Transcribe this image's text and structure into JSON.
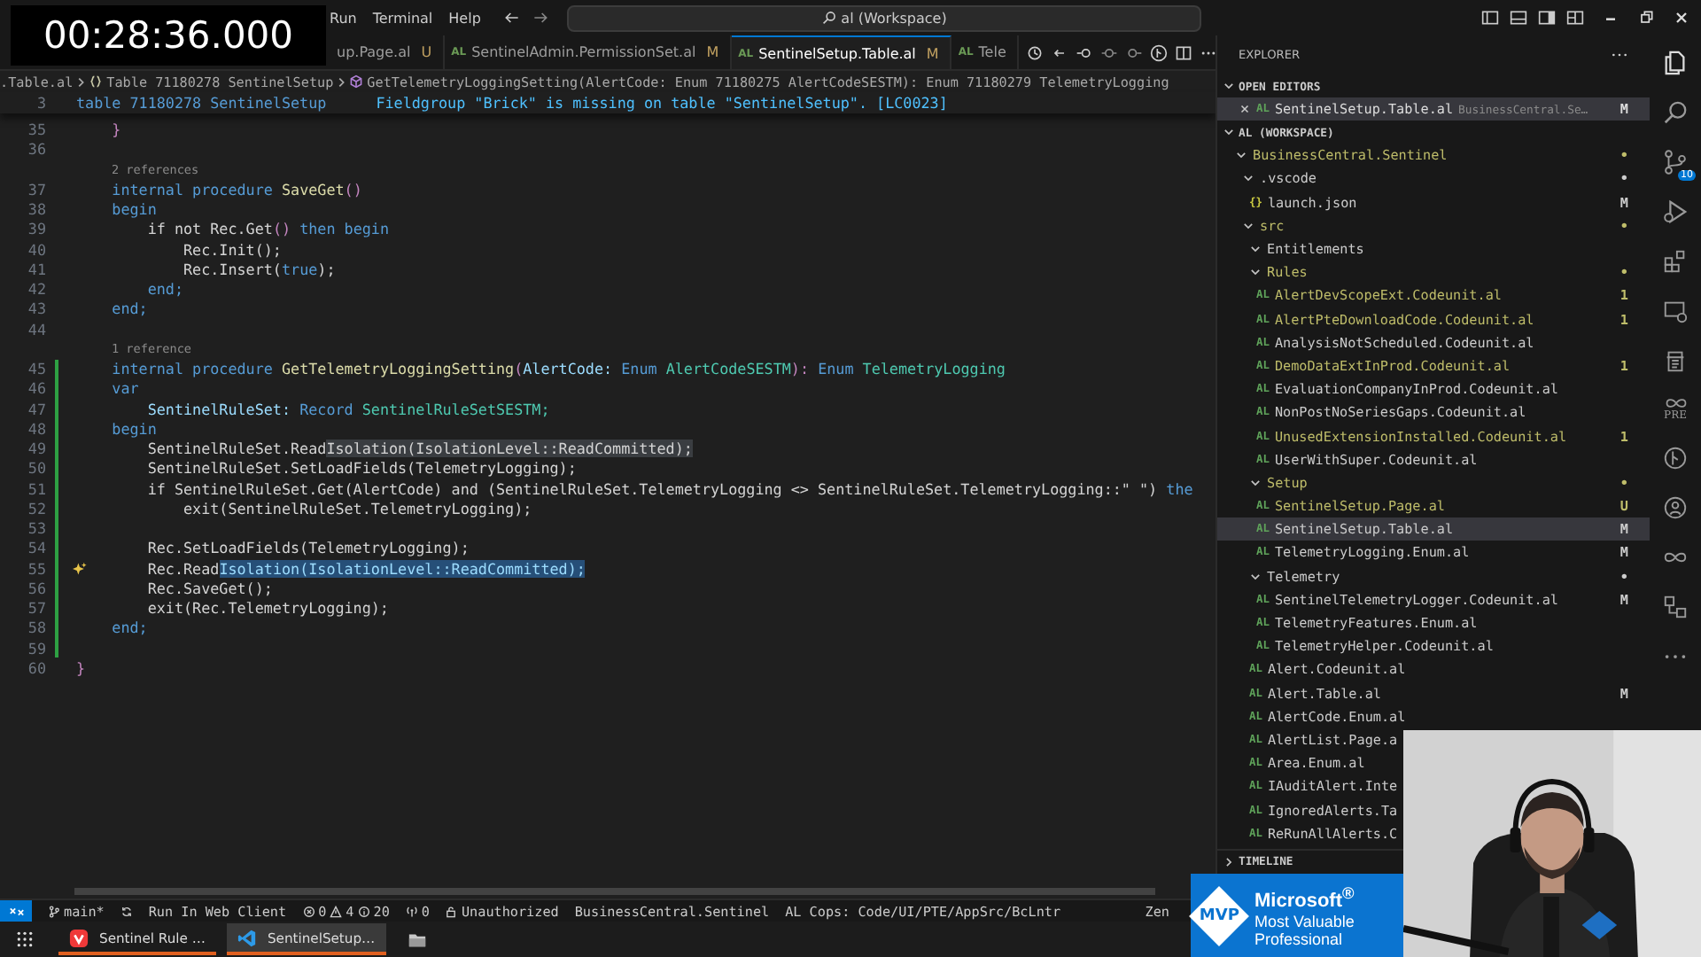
{
  "timer": "00:28:36.000",
  "menu": [
    "Run",
    "Terminal",
    "Help"
  ],
  "search": {
    "value": "al (Workspace)"
  },
  "tabs": [
    {
      "label": "up.Page.al",
      "badge": "U",
      "selected": false
    },
    {
      "icon": "AL",
      "label": "SentinelAdmin.PermissionSet.al",
      "badge": "M",
      "selected": false
    },
    {
      "icon": "AL",
      "label": "SentinelSetup.Table.al",
      "badge": "M",
      "selected": true
    },
    {
      "icon": "AL",
      "label": "Tele",
      "selected": false
    }
  ],
  "breadcrumb": [
    {
      "kind": "file",
      "text": ".Table.al"
    },
    {
      "kind": "table",
      "text": "Table 71180278 SentinelSetup"
    },
    {
      "kind": "method",
      "text": "GetTelemetryLoggingSetting(AlertCode: Enum 71180275 AlertCodeSESTM): Enum 71180279 TelemetryLogging"
    }
  ],
  "sticky": {
    "number": "3",
    "code": "table 71180278 SentinelSetup",
    "diagnostic": "Fieldgroup \"Brick\" is missing on table \"SentinelSetup\". [LC0023]"
  },
  "code": [
    {
      "kind": "code",
      "num": "35",
      "changed": false,
      "segs": [
        {
          "text": "    }",
          "kind": "control"
        }
      ]
    },
    {
      "kind": "code",
      "num": "36",
      "changed": false
    },
    {
      "kind": "lens",
      "text": "2 references"
    },
    {
      "kind": "code",
      "num": "37",
      "changed": false,
      "segs": [
        {
          "text": "    internal procedure ",
          "kind": "keyword"
        },
        {
          "text": "SaveGet",
          "kind": "function"
        },
        {
          "text": "()",
          "kind": "control"
        }
      ]
    },
    {
      "kind": "code",
      "num": "38",
      "changed": false,
      "segs": [
        {
          "text": "    begin",
          "kind": "keyword"
        }
      ]
    },
    {
      "kind": "code",
      "num": "39",
      "changed": false,
      "segs": [
        {
          "text": "        if not Rec.Get",
          "kind": "plain"
        },
        {
          "text": "()",
          "kind": "control"
        },
        {
          "text": " then begin",
          "kind": "keyword"
        }
      ]
    },
    {
      "kind": "code",
      "num": "40",
      "changed": false,
      "segs": [
        {
          "text": "            Rec.Init();",
          "kind": "plain"
        }
      ]
    },
    {
      "kind": "code",
      "num": "41",
      "changed": false,
      "segs": [
        {
          "text": "            Rec.Insert(",
          "kind": "plain"
        },
        {
          "text": "true",
          "kind": "keyword"
        },
        {
          "text": ");",
          "kind": "plain"
        }
      ]
    },
    {
      "kind": "code",
      "num": "42",
      "changed": false,
      "segs": [
        {
          "text": "        end;",
          "kind": "keyword"
        }
      ]
    },
    {
      "kind": "code",
      "num": "43",
      "changed": false,
      "segs": [
        {
          "text": "    end;",
          "kind": "keyword"
        }
      ]
    },
    {
      "kind": "code",
      "num": "44",
      "changed": false
    },
    {
      "kind": "lens",
      "text": "1 reference"
    },
    {
      "kind": "code",
      "num": "45",
      "changed": true,
      "segs": [
        {
          "text": "    internal procedure ",
          "kind": "keyword"
        },
        {
          "text": "GetTelemetryLoggingSetting",
          "kind": "function"
        },
        {
          "text": "(",
          "kind": "control"
        },
        {
          "text": "AlertCode: ",
          "kind": "variable"
        },
        {
          "text": "Enum ",
          "kind": "keyword"
        },
        {
          "text": "AlertCodeSESTM",
          "kind": "type"
        },
        {
          "text": "): ",
          "kind": "control"
        },
        {
          "text": "Enum ",
          "kind": "keyword"
        },
        {
          "text": "TelemetryLogging",
          "kind": "type"
        }
      ]
    },
    {
      "kind": "code",
      "num": "46",
      "changed": true,
      "segs": [
        {
          "text": "    var",
          "kind": "keyword"
        }
      ]
    },
    {
      "kind": "code",
      "num": "47",
      "changed": true,
      "segs": [
        {
          "text": "        SentinelRuleSet: ",
          "kind": "variable"
        },
        {
          "text": "Record ",
          "kind": "keyword"
        },
        {
          "text": "SentinelRuleSetSESTM;",
          "kind": "type"
        }
      ]
    },
    {
      "kind": "code",
      "num": "48",
      "changed": true,
      "segs": [
        {
          "text": "    begin",
          "kind": "keyword"
        }
      ]
    },
    {
      "kind": "code",
      "num": "49",
      "changed": true,
      "segs": [
        {
          "text": "        SentinelRuleSet.Read",
          "kind": "plain"
        },
        {
          "text": "Isolation(IsolationLevel::ReadCommitted);",
          "kind": "highlight"
        }
      ]
    },
    {
      "kind": "code",
      "num": "50",
      "changed": true,
      "segs": [
        {
          "text": "        SentinelRuleSet.SetLoadFields(TelemetryLogging);",
          "kind": "plain"
        }
      ]
    },
    {
      "kind": "code",
      "num": "51",
      "changed": true,
      "segs": [
        {
          "text": "        if SentinelRuleSet.Get(AlertCode) and (SentinelRuleSet.TelemetryLogging <> SentinelRuleSet.TelemetryLogging::\" \") ",
          "kind": "plain"
        },
        {
          "text": "the",
          "kind": "keyword"
        }
      ]
    },
    {
      "kind": "code",
      "num": "52",
      "changed": true,
      "segs": [
        {
          "text": "            exit(SentinelRuleSet.TelemetryLogging);",
          "kind": "plain"
        }
      ]
    },
    {
      "kind": "code",
      "num": "53",
      "changed": true
    },
    {
      "kind": "code",
      "num": "54",
      "changed": true,
      "segs": [
        {
          "text": "        Rec.SetLoadFields(TelemetryLogging);",
          "kind": "plain"
        }
      ]
    },
    {
      "kind": "hinted",
      "num": "55",
      "changed": true,
      "segs": [
        {
          "text": "        Rec.Read",
          "kind": "plain"
        },
        {
          "text": "Isolation(IsolationLevel::ReadCommitted);",
          "kind": "selection"
        }
      ]
    },
    {
      "kind": "code",
      "num": "56",
      "changed": true,
      "segs": [
        {
          "text": "        Rec.SaveGet();",
          "kind": "plain"
        }
      ]
    },
    {
      "kind": "code",
      "num": "57",
      "changed": true,
      "segs": [
        {
          "text": "        exit(Rec.TelemetryLogging);",
          "kind": "plain"
        }
      ]
    },
    {
      "kind": "code",
      "num": "58",
      "changed": true,
      "segs": [
        {
          "text": "    end;",
          "kind": "keyword"
        }
      ]
    },
    {
      "kind": "code",
      "num": "59",
      "changed": true
    },
    {
      "kind": "code",
      "num": "60",
      "changed": false,
      "segs": [
        {
          "text": "}",
          "kind": "control"
        }
      ]
    }
  ],
  "explorer": {
    "title": "EXPLORER"
  },
  "open_editors": {
    "title": "OPEN EDITORS",
    "expanded": true,
    "items": [
      {
        "icon": "AL",
        "name": "SentinelSetup.Table.al",
        "path": "BusinessCentral.Se…",
        "badge": "M",
        "selected": true
      }
    ]
  },
  "workspace": {
    "title": "AL (WORKSPACE)",
    "expanded": true,
    "tree": [
      {
        "name": "BusinessCentral.Sentinel",
        "color": "#bfbd6a",
        "badge": "•",
        "selected": false,
        "expanded": true,
        "children": [
          {
            "name": ".vscode",
            "color": "#cccccc",
            "badge": "•",
            "selected": false,
            "expanded": true,
            "children": [
              {
                "icon": "{}",
                "name": "launch.json",
                "color": "#cccccc",
                "badge": "M",
                "selected": false
              }
            ]
          },
          {
            "name": "src",
            "color": "#bfbd6a",
            "badge": "•",
            "selected": false,
            "expanded": true,
            "children": [
              {
                "name": "Entitlements",
                "color": "#cccccc",
                "selected": false,
                "expanded": true
              },
              {
                "name": "Rules",
                "color": "#bfbd6a",
                "badge": "•",
                "selected": false,
                "expanded": true,
                "children": [
                  {
                    "icon": "AL",
                    "name": "AlertDevScopeExt.Codeunit.al",
                    "color": "#bfbd6a",
                    "badge": "1",
                    "selected": false
                  },
                  {
                    "icon": "AL",
                    "name": "AlertPteDownloadCode.Codeunit.al",
                    "color": "#bfbd6a",
                    "badge": "1",
                    "selected": false
                  },
                  {
                    "icon": "AL",
                    "name": "AnalysisNotScheduled.Codeunit.al",
                    "color": "#cccccc",
                    "selected": false
                  },
                  {
                    "icon": "AL",
                    "name": "DemoDataExtInProd.Codeunit.al",
                    "color": "#bfbd6a",
                    "badge": "1",
                    "selected": false
                  },
                  {
                    "icon": "AL",
                    "name": "EvaluationCompanyInProd.Codeunit.al",
                    "color": "#cccccc",
                    "selected": false
                  },
                  {
                    "icon": "AL",
                    "name": "NonPostNoSeriesGaps.Codeunit.al",
                    "color": "#cccccc",
                    "selected": false
                  },
                  {
                    "icon": "AL",
                    "name": "UnusedExtensionInstalled.Codeunit.al",
                    "color": "#bfbd6a",
                    "badge": "1",
                    "selected": false
                  },
                  {
                    "icon": "AL",
                    "name": "UserWithSuper.Codeunit.al",
                    "color": "#cccccc",
                    "selected": false
                  }
                ]
              },
              {
                "name": "Setup",
                "color": "#bfbd6a",
                "badge": "•",
                "selected": false,
                "expanded": true,
                "children": [
                  {
                    "icon": "AL",
                    "name": "SentinelSetup.Page.al",
                    "color": "#bfbd6a",
                    "badge": "U",
                    "selected": false
                  },
                  {
                    "icon": "AL",
                    "name": "SentinelSetup.Table.al",
                    "color": "#cccccc",
                    "badge": "M",
                    "selected": true
                  },
                  {
                    "icon": "AL",
                    "name": "TelemetryLogging.Enum.al",
                    "color": "#cccccc",
                    "badge": "M",
                    "selected": false
                  }
                ]
              },
              {
                "name": "Telemetry",
                "color": "#cccccc",
                "badge": "•",
                "selected": false,
                "expanded": true,
                "children": [
                  {
                    "icon": "AL",
                    "name": "SentinelTelemetryLogger.Codeunit.al",
                    "color": "#cccccc",
                    "badge": "M",
                    "selected": false
                  },
                  {
                    "icon": "AL",
                    "name": "TelemetryFeatures.Enum.al",
                    "color": "#cccccc",
                    "selected": false
                  },
                  {
                    "icon": "AL",
                    "name": "TelemetryHelper.Codeunit.al",
                    "color": "#cccccc",
                    "selected": false
                  }
                ]
              },
              {
                "icon": "AL",
                "name": "Alert.Codeunit.al",
                "color": "#cccccc",
                "selected": false
              },
              {
                "icon": "AL",
                "name": "Alert.Table.al",
                "color": "#cccccc",
                "badge": "M",
                "selected": false
              },
              {
                "icon": "AL",
                "name": "AlertCode.Enum.al",
                "color": "#cccccc",
                "selected": false
              },
              {
                "icon": "AL",
                "name": "AlertList.Page.a",
                "color": "#cccccc",
                "selected": false
              },
              {
                "icon": "AL",
                "name": "Area.Enum.al",
                "color": "#cccccc",
                "selected": false
              },
              {
                "icon": "AL",
                "name": "IAuditAlert.Inte",
                "color": "#cccccc",
                "selected": false
              },
              {
                "icon": "AL",
                "name": "IgnoredAlerts.Ta",
                "color": "#cccccc",
                "selected": false
              },
              {
                "icon": "AL",
                "name": "ReRunAllAlerts.C",
                "color": "#cccccc",
                "selected": false
              }
            ]
          }
        ]
      }
    ]
  },
  "timeline": {
    "title": "TIMELINE",
    "expanded": false
  },
  "activity_bar": {
    "scm_badge": "10",
    "pre_label": "PRE"
  },
  "status_bar": {
    "branch": "main*",
    "run": "Run In Web Client",
    "errors": "0",
    "warnings": "4",
    "infos": "20",
    "ports": "0",
    "auth": "Unauthorized",
    "project": "BusinessCentral.Sentinel",
    "cops": "AL Cops: Code/UI/PTE/AppSrc/BcLntr",
    "zen": "Zen"
  },
  "taskbar": [
    {
      "kind": "browser",
      "label": "Sentinel Rule …",
      "running": true,
      "selected": false
    },
    {
      "kind": "editor",
      "label": "SentinelSetup…",
      "running": true,
      "selected": true
    },
    {
      "kind": "folder",
      "running": false,
      "selected": false
    }
  ],
  "mvp_badge": {
    "logo": "MVP",
    "lines": [
      "Microsoft$^{®}$",
      "Most Valuable",
      "Professional"
    ]
  },
  "webcam": {
    "kind": "picture"
  }
}
